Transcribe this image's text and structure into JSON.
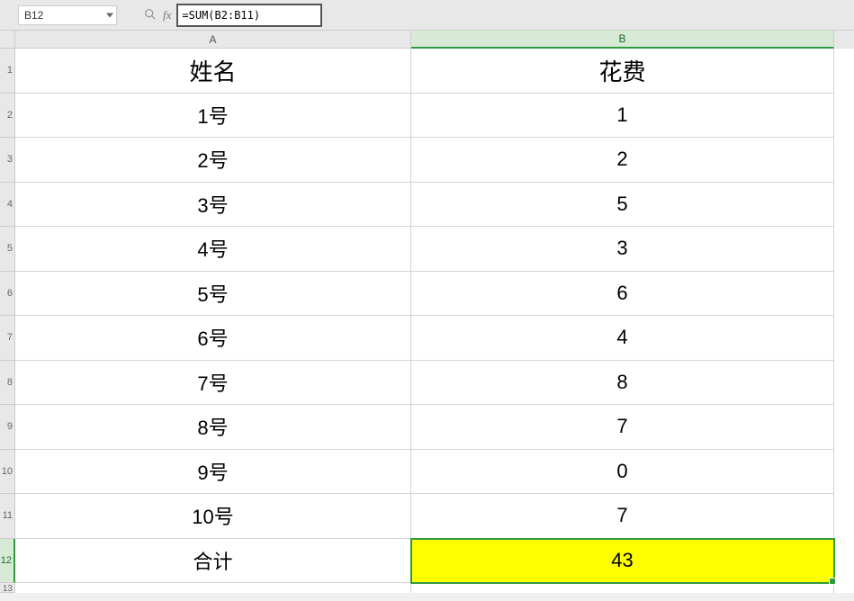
{
  "formula_bar": {
    "cell_reference": "B12",
    "fx_label": "fx",
    "formula": "=SUM(B2:B11)"
  },
  "columns": {
    "a": "A",
    "b": "B"
  },
  "row_headers": [
    "1",
    "2",
    "3",
    "4",
    "5",
    "6",
    "7",
    "8",
    "9",
    "10",
    "11",
    "12",
    "13"
  ],
  "headers": {
    "name": "姓名",
    "cost": "花费"
  },
  "data_rows": [
    {
      "name": "1号",
      "cost": "1"
    },
    {
      "name": "2号",
      "cost": "2"
    },
    {
      "name": "3号",
      "cost": "5"
    },
    {
      "name": "4号",
      "cost": "3"
    },
    {
      "name": "5号",
      "cost": "6"
    },
    {
      "name": "6号",
      "cost": "4"
    },
    {
      "name": "7号",
      "cost": "8"
    },
    {
      "name": "8号",
      "cost": "7"
    },
    {
      "name": "9号",
      "cost": "0"
    },
    {
      "name": "10号",
      "cost": "7"
    }
  ],
  "total_row": {
    "label": "合计",
    "value": "43"
  },
  "chart_data": {
    "type": "table",
    "columns": [
      "姓名",
      "花费"
    ],
    "rows": [
      [
        "1号",
        1
      ],
      [
        "2号",
        2
      ],
      [
        "3号",
        5
      ],
      [
        "4号",
        3
      ],
      [
        "5号",
        6
      ],
      [
        "6号",
        4
      ],
      [
        "7号",
        8
      ],
      [
        "8号",
        7
      ],
      [
        "9号",
        0
      ],
      [
        "10号",
        7
      ],
      [
        "合计",
        43
      ]
    ]
  }
}
